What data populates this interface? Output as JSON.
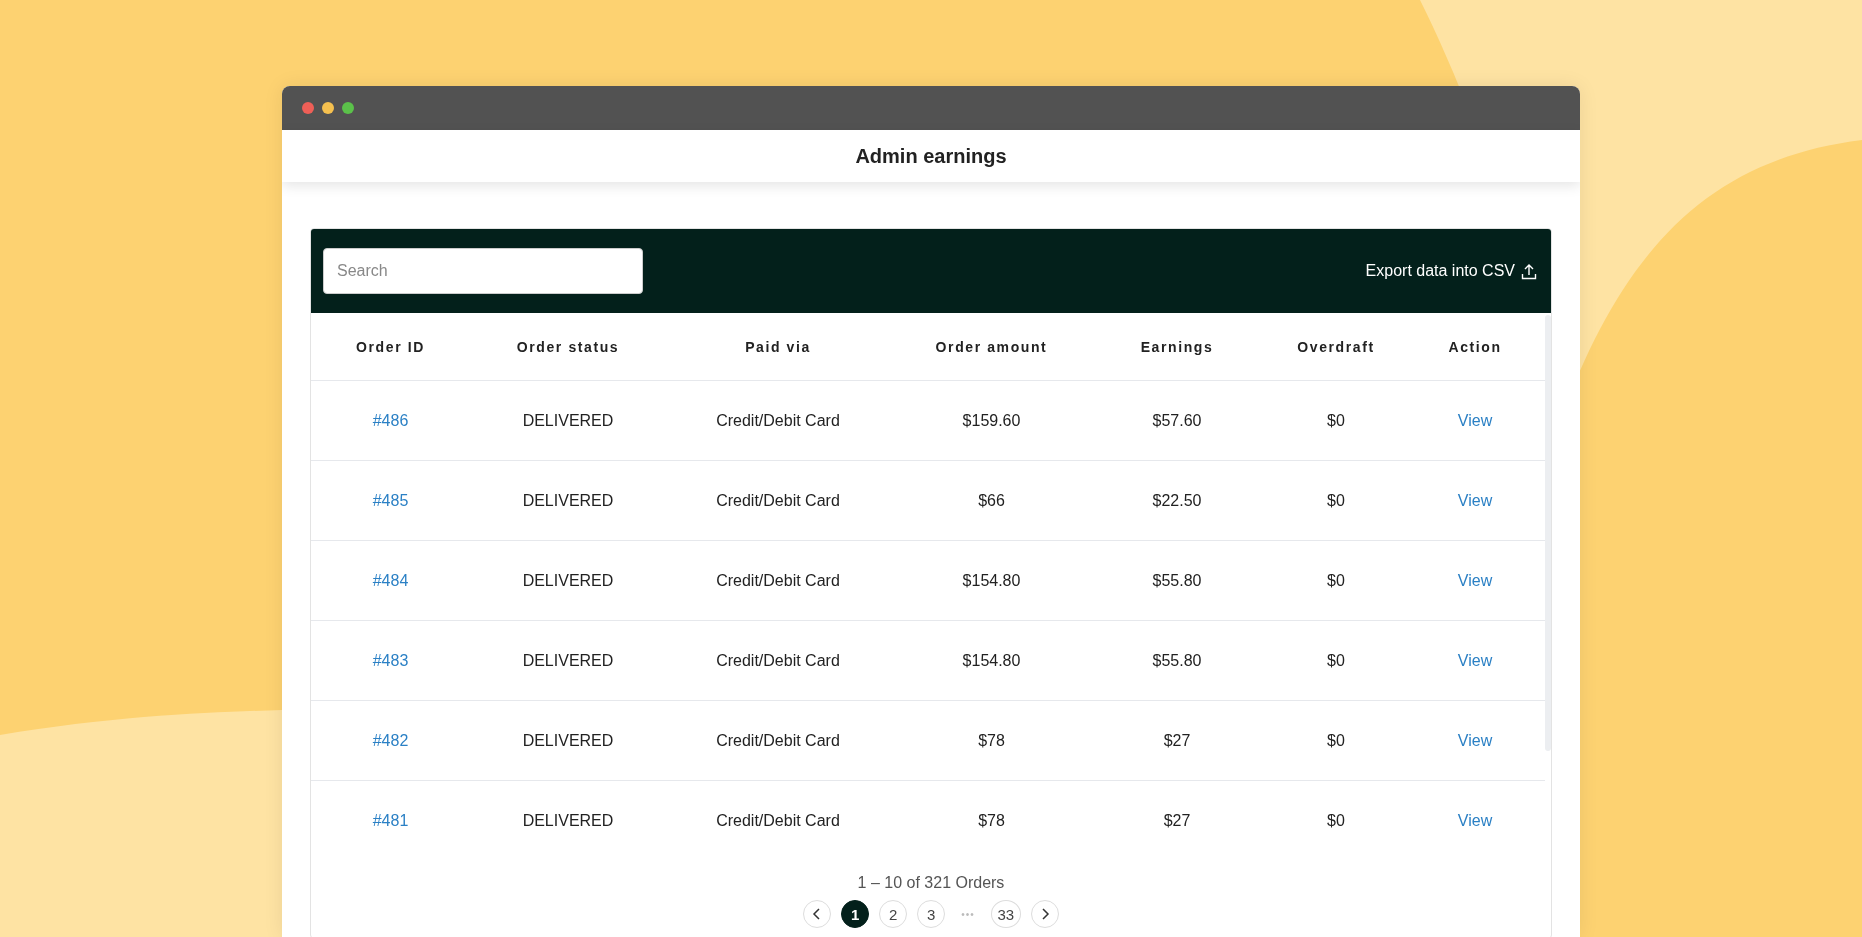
{
  "window": {
    "title": "Admin earnings"
  },
  "toolbar": {
    "search": {
      "placeholder": "Search"
    },
    "export_label": "Export data into CSV"
  },
  "table": {
    "columns": [
      "Order ID",
      "Order status",
      "Paid via",
      "Order amount",
      "Earnings",
      "Overdraft",
      "Action"
    ],
    "rows": [
      {
        "order_id": "#486",
        "status": "DELIVERED",
        "paid_via": "Credit/Debit Card",
        "amount": "$159.60",
        "earnings": "$57.60",
        "overdraft": "$0",
        "action": "View"
      },
      {
        "order_id": "#485",
        "status": "DELIVERED",
        "paid_via": "Credit/Debit Card",
        "amount": "$66",
        "earnings": "$22.50",
        "overdraft": "$0",
        "action": "View"
      },
      {
        "order_id": "#484",
        "status": "DELIVERED",
        "paid_via": "Credit/Debit Card",
        "amount": "$154.80",
        "earnings": "$55.80",
        "overdraft": "$0",
        "action": "View"
      },
      {
        "order_id": "#483",
        "status": "DELIVERED",
        "paid_via": "Credit/Debit Card",
        "amount": "$154.80",
        "earnings": "$55.80",
        "overdraft": "$0",
        "action": "View"
      },
      {
        "order_id": "#482",
        "status": "DELIVERED",
        "paid_via": "Credit/Debit Card",
        "amount": "$78",
        "earnings": "$27",
        "overdraft": "$0",
        "action": "View"
      },
      {
        "order_id": "#481",
        "status": "DELIVERED",
        "paid_via": "Credit/Debit Card",
        "amount": "$78",
        "earnings": "$27",
        "overdraft": "$0",
        "action": "View"
      }
    ]
  },
  "pagination": {
    "summary": "1 – 10 of 321 Orders",
    "items": [
      {
        "kind": "prev"
      },
      {
        "kind": "page",
        "label": "1",
        "selected": true
      },
      {
        "kind": "page",
        "label": "2",
        "selected": false
      },
      {
        "kind": "page",
        "label": "3",
        "selected": false
      },
      {
        "kind": "ellipsis",
        "label": "•••"
      },
      {
        "kind": "page",
        "label": "33",
        "selected": false
      },
      {
        "kind": "next"
      }
    ]
  }
}
